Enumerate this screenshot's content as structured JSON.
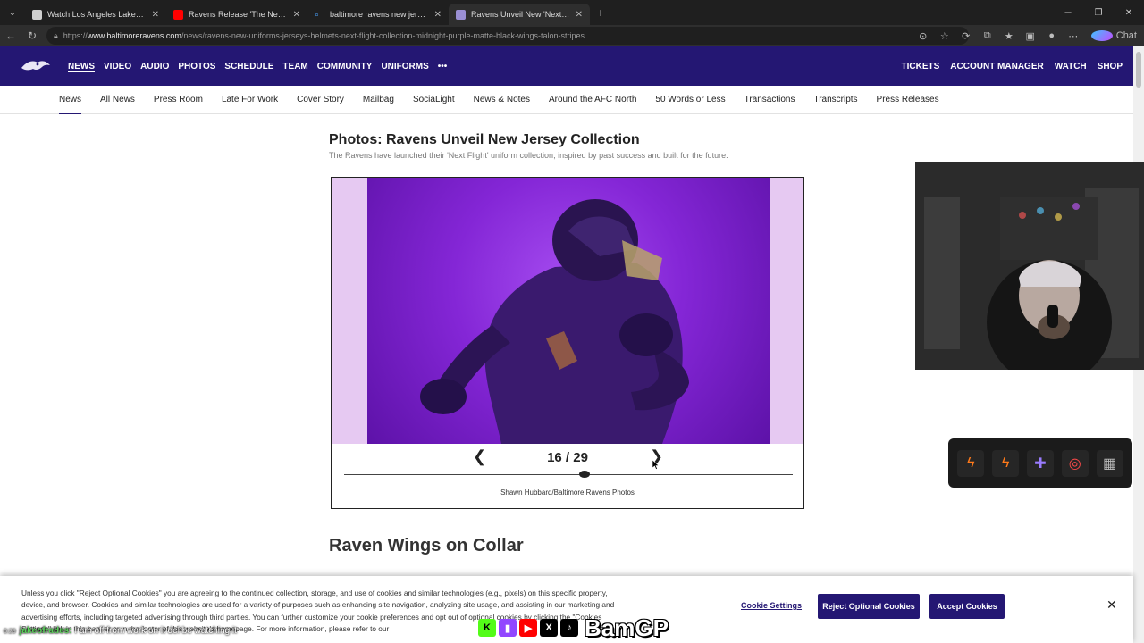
{
  "browser": {
    "tabs": [
      {
        "title": "Watch Los Angeles Lakers vs Hous",
        "fav_color": "#cfcfcf"
      },
      {
        "title": "Ravens Release 'The Next Flight' U",
        "fav_color": "#ff0000"
      },
      {
        "title": "baltimore ravens new jerseys - Sea",
        "fav_color": "#4aa3ff"
      },
      {
        "title": "Ravens Unveil New 'Next Flight' U",
        "fav_color": "#9a8fd4"
      }
    ],
    "url_prefix": "https://",
    "url_host": "www.baltimoreravens.com",
    "url_path": "/news/ravens-new-uniforms-jerseys-helmets-next-flight-collection-midnight-purple-matte-black-wings-talon-stripes",
    "chat_label": "Chat"
  },
  "site": {
    "brand_color": "#241773",
    "main_nav": [
      "NEWS",
      "VIDEO",
      "AUDIO",
      "PHOTOS",
      "SCHEDULE",
      "TEAM",
      "COMMUNITY",
      "UNIFORMS"
    ],
    "more_glyph": "•••",
    "right_nav": [
      "TICKETS",
      "ACCOUNT MANAGER",
      "WATCH",
      "SHOP"
    ],
    "sub_nav": [
      "News",
      "All News",
      "Press Room",
      "Late For Work",
      "Cover Story",
      "Mailbag",
      "SociaLight",
      "News & Notes",
      "Around the AFC North",
      "50 Words or Less",
      "Transactions",
      "Transcripts",
      "Press Releases"
    ]
  },
  "article": {
    "title": "Photos: Ravens Unveil New Jersey Collection",
    "subtitle": "The Ravens have launched their 'Next Flight' uniform collection, inspired by past success and built for the future.",
    "gallery": {
      "counter": "16 / 29",
      "current": 16,
      "total": 29,
      "credit": "Shawn Hubbard/Baltimore Ravens Photos"
    },
    "section_heading": "Raven Wings on Collar"
  },
  "cookie_banner": {
    "text": "Unless you click \"Reject Optional Cookies\" you are agreeing to the continued collection, storage, and use of cookies and similar technologies (e.g., pixels) on this specific property, device, and browser. Cookies and similar technologies are used for a variety of purposes such as enhancing site navigation, analyzing site usage, and assisting in our marketing and advertising efforts, including targeted advertising through third parties. You can further customize your cookie preferences and opt out of optional cookies by clicking the \"Cookies Settings\" link in this banner or in the footer of this website's homepage. For more information, please refer to our",
    "settings_label": "Cookie Settings",
    "reject_label": "Reject Optional Cookies",
    "accept_label": "Accept Cookies"
  },
  "overlay": {
    "chat_time": "0:29",
    "chat_user": "jakeofrades:",
    "chat_message": "I am off from work on it del be watching it",
    "brand_name": "BamGP"
  }
}
